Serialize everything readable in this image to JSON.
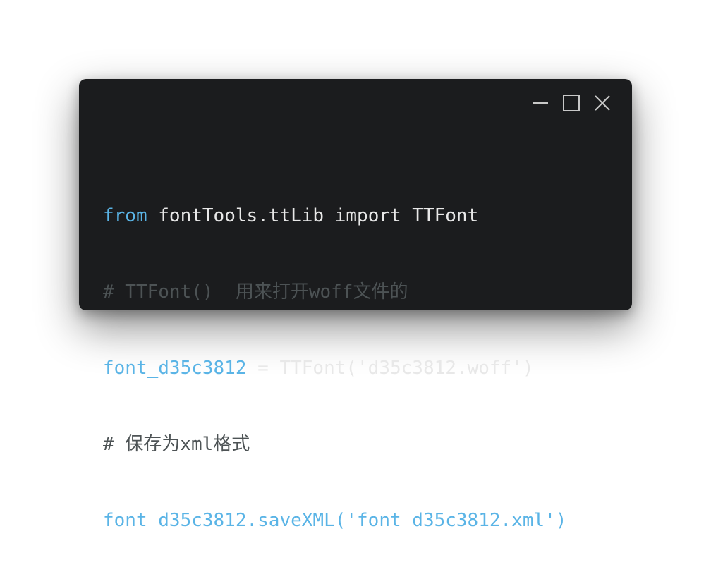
{
  "window": {
    "controls": {
      "minimize_icon": "minimize-icon",
      "maximize_icon": "maximize-icon",
      "close_icon": "close-icon"
    }
  },
  "code": {
    "line1": {
      "keyword_from": "from",
      "module": " fontTools.ttLib ",
      "keyword_import": "import",
      "name": " TTFont"
    },
    "line2": {
      "comment": "# TTFont()  用来打开woff文件的"
    },
    "line3": {
      "variable": "font_d35c3812",
      "assign": " = TTFont('d35c3812.woff')"
    },
    "line4": {
      "comment": "# 保存为xml格式"
    },
    "line5": {
      "text": "font_d35c3812.saveXML('font_d35c3812.xml')"
    }
  },
  "colors": {
    "background": "#1b1c1e",
    "keyword": "#5ab4e6",
    "plain": "#e8e8e8",
    "comment": "#4d5355"
  }
}
